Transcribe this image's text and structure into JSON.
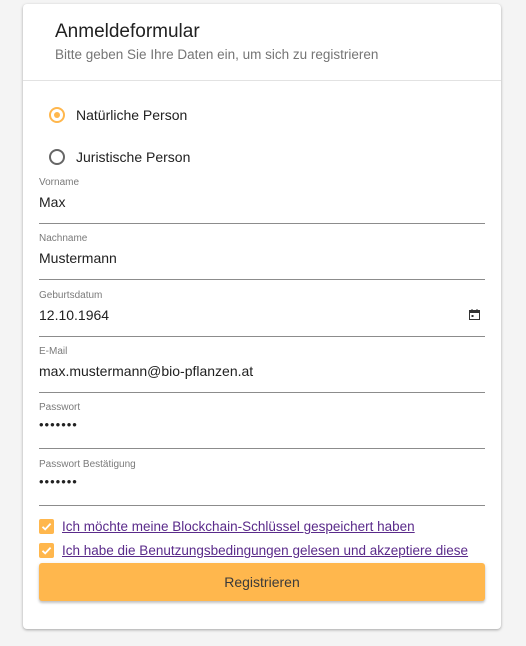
{
  "form": {
    "title": "Anmeldeformular",
    "subtitle": "Bitte geben Sie Ihre Daten ein, um sich zu registrieren"
  },
  "person_type": {
    "options": [
      {
        "label": "Natürliche Person",
        "selected": true
      },
      {
        "label": "Juristische Person",
        "selected": false
      }
    ]
  },
  "fields": {
    "vorname": {
      "label": "Vorname",
      "value": "Max"
    },
    "nachname": {
      "label": "Nachname",
      "value": "Mustermann"
    },
    "geburtsdatum": {
      "label": "Geburtsdatum",
      "value": "12.10.1964",
      "icon": "calendar-icon"
    },
    "email": {
      "label": "E-Mail",
      "value": "max.mustermann@bio-pflanzen.at"
    },
    "passwort": {
      "label": "Passwort",
      "value": "•••••••"
    },
    "passwort_bestaetigung": {
      "label": "Passwort Bestätigung",
      "value": "•••••••"
    }
  },
  "checkboxes": [
    {
      "label": "Ich möchte meine Blockchain-Schlüssel gespeichert haben",
      "checked": true
    },
    {
      "label": "Ich habe die Benutzungsbedingungen gelesen und akzeptiere diese",
      "checked": true
    }
  ],
  "submit": {
    "label": "Registrieren"
  },
  "colors": {
    "accent": "#ffb74d",
    "link": "#5a2a8a",
    "background": "#f4f4f4",
    "card": "#ffffff"
  }
}
